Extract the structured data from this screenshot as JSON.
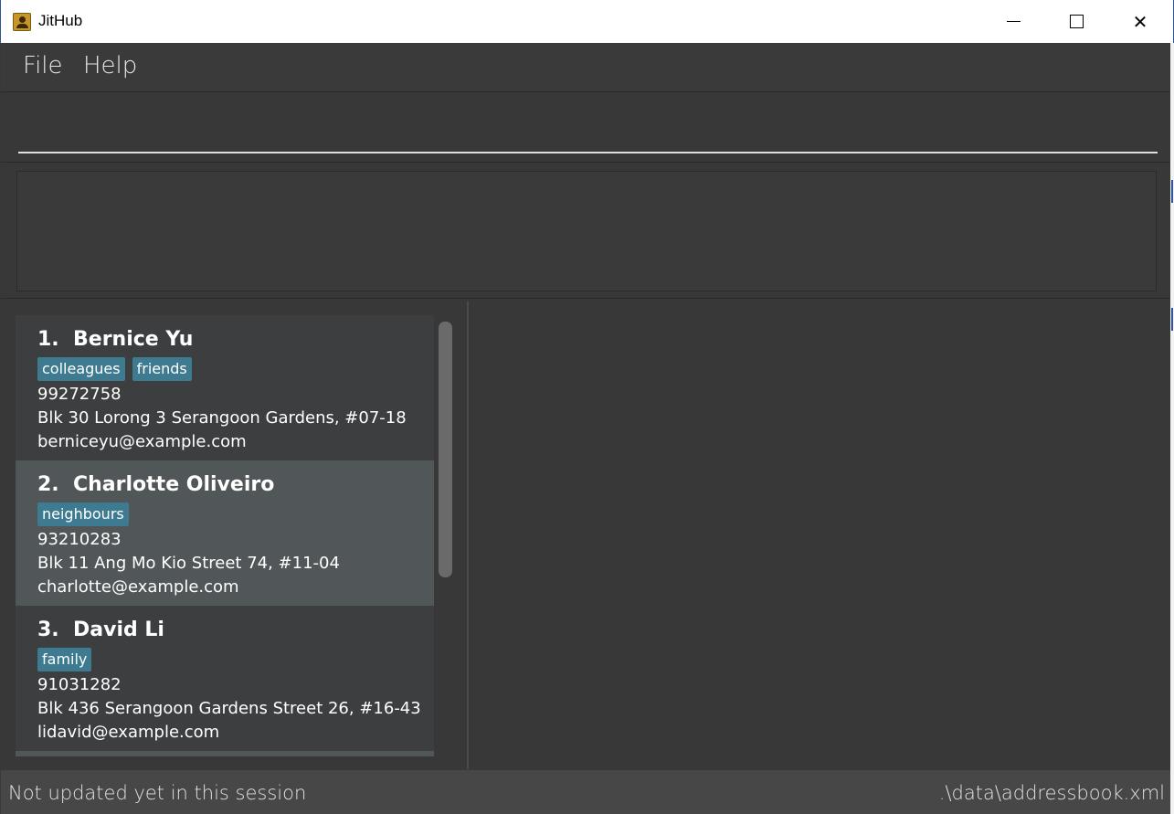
{
  "window": {
    "title": "JitHub",
    "icon": "contact-book-icon",
    "minimize_icon": "minimize-icon",
    "maximize_icon": "maximize-icon",
    "close_icon": "close-icon",
    "close_glyph": "✕"
  },
  "menu": {
    "file": "File",
    "help": "Help"
  },
  "command": {
    "value": "",
    "placeholder": ""
  },
  "result": {
    "text": ""
  },
  "persons": [
    {
      "index": "1.",
      "name": "Bernice Yu",
      "tags": [
        "colleagues",
        "friends"
      ],
      "phone": "99272758",
      "address": "Blk 30 Lorong 3 Serangoon Gardens, #07-18",
      "email": "berniceyu@example.com",
      "selected": false
    },
    {
      "index": "2.",
      "name": "Charlotte Oliveiro",
      "tags": [
        "neighbours"
      ],
      "phone": "93210283",
      "address": "Blk 11 Ang Mo Kio Street 74, #11-04",
      "email": "charlotte@example.com",
      "selected": true
    },
    {
      "index": "3.",
      "name": "David Li",
      "tags": [
        "family"
      ],
      "phone": "91031282",
      "address": "Blk 436 Serangoon Gardens Street 26, #16-43",
      "email": "lidavid@example.com",
      "selected": false
    }
  ],
  "status": {
    "sync": "Not updated yet in this session",
    "path": ".\\data\\addressbook.xml"
  },
  "colors": {
    "background": "#383838",
    "card": "#3c3e3f",
    "card_selected": "#515658",
    "tag": "#3e7b91",
    "statusbar": "#474747"
  }
}
